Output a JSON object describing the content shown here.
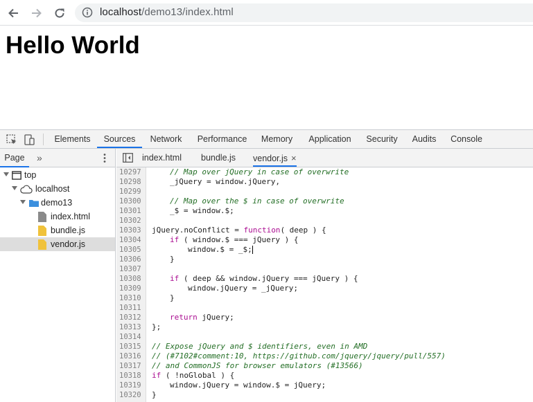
{
  "browser": {
    "url_host": "localhost",
    "url_path": "/demo13/index.html"
  },
  "page": {
    "heading": "Hello World"
  },
  "devtools": {
    "tabs": [
      {
        "label": "Elements",
        "active": false
      },
      {
        "label": "Sources",
        "active": true
      },
      {
        "label": "Network",
        "active": false
      },
      {
        "label": "Performance",
        "active": false
      },
      {
        "label": "Memory",
        "active": false
      },
      {
        "label": "Application",
        "active": false
      },
      {
        "label": "Security",
        "active": false
      },
      {
        "label": "Audits",
        "active": false
      },
      {
        "label": "Console",
        "active": false
      }
    ],
    "navigator": {
      "page_tab": "Page",
      "more": "»",
      "tree": [
        {
          "label": "top",
          "type": "frame",
          "level": 0
        },
        {
          "label": "localhost",
          "type": "cloud",
          "level": 1
        },
        {
          "label": "demo13",
          "type": "folder",
          "level": 2
        },
        {
          "label": "index.html",
          "type": "file-html",
          "level": 3
        },
        {
          "label": "bundle.js",
          "type": "file-js",
          "level": 3
        },
        {
          "label": "vendor.js",
          "type": "file-js",
          "level": 3,
          "selected": true
        }
      ]
    },
    "editor": {
      "tabs": [
        {
          "label": "index.html",
          "active": false
        },
        {
          "label": "bundle.js",
          "active": false
        },
        {
          "label": "vendor.js",
          "active": true,
          "closable": true
        }
      ],
      "close_glyph": "×",
      "lines": [
        {
          "n": "10297",
          "t": "\t// Map over jQuery in case of overwrite",
          "c": true
        },
        {
          "n": "10298",
          "t": "\t_jQuery = window.jQuery,"
        },
        {
          "n": "10299",
          "t": ""
        },
        {
          "n": "10300",
          "t": "\t// Map over the $ in case of overwrite",
          "c": true
        },
        {
          "n": "10301",
          "t": "\t_$ = window.$;"
        },
        {
          "n": "10302",
          "t": ""
        },
        {
          "n": "10303",
          "t": "jQuery.noConflict = function( deep ) {"
        },
        {
          "n": "10304",
          "t": "\tif ( window.$ === jQuery ) {"
        },
        {
          "n": "10305",
          "t": "\t\twindow.$ = _$;",
          "cursor": true
        },
        {
          "n": "10306",
          "t": "\t}"
        },
        {
          "n": "10307",
          "t": ""
        },
        {
          "n": "10308",
          "t": "\tif ( deep && window.jQuery === jQuery ) {"
        },
        {
          "n": "10309",
          "t": "\t\twindow.jQuery = _jQuery;"
        },
        {
          "n": "10310",
          "t": "\t}"
        },
        {
          "n": "10311",
          "t": ""
        },
        {
          "n": "10312",
          "t": "\treturn jQuery;"
        },
        {
          "n": "10313",
          "t": "};"
        },
        {
          "n": "10314",
          "t": ""
        },
        {
          "n": "10315",
          "t": "// Expose jQuery and $ identifiers, even in AMD",
          "c": true
        },
        {
          "n": "10316",
          "t": "// (#7102#comment:10, https://github.com/jquery/jquery/pull/557)",
          "c": true
        },
        {
          "n": "10317",
          "t": "// and CommonJS for browser emulators (#13566)",
          "c": true
        },
        {
          "n": "10318",
          "t": "if ( !noGlobal ) {"
        },
        {
          "n": "10319",
          "t": "\twindow.jQuery = window.$ = jQuery;"
        },
        {
          "n": "10320",
          "t": "}"
        }
      ]
    }
  },
  "colors": {
    "accent": "#1a73e8",
    "comment": "#236e25"
  }
}
